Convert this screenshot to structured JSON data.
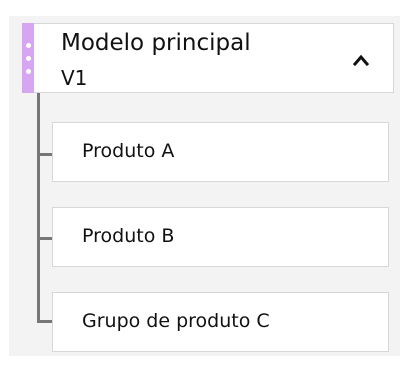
{
  "header": {
    "title": "Modelo principal",
    "subtitle": "V1",
    "toggle_icon": "chevron-up-icon",
    "accent_color": "#d7a6f2"
  },
  "children": [
    {
      "label": "Produto A"
    },
    {
      "label": "Produto B"
    },
    {
      "label": "Grupo de produto C"
    }
  ]
}
